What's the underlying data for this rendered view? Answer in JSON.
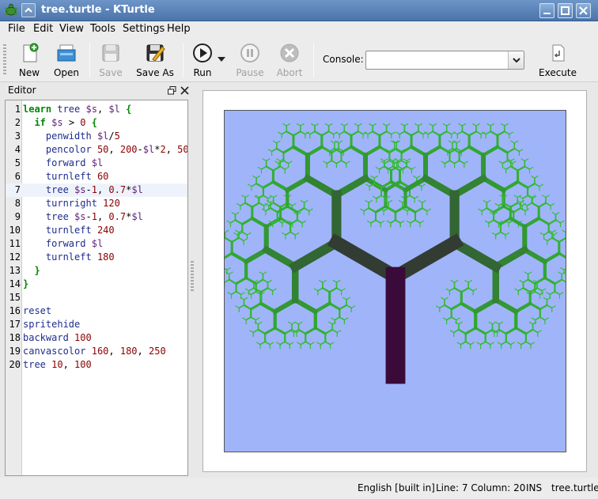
{
  "window": {
    "title": "tree.turtle - KTurtle"
  },
  "menubar": {
    "items": [
      "File",
      "Edit",
      "View",
      "Tools",
      "Settings",
      "Help"
    ]
  },
  "toolbar": {
    "new_label": "New",
    "open_label": "Open",
    "save_label": "Save",
    "save_as_label": "Save As",
    "run_label": "Run",
    "pause_label": "Pause",
    "abort_label": "Abort",
    "console_label": "Console:",
    "console_value": "",
    "execute_label": "Execute"
  },
  "editor": {
    "dock_title": "Editor",
    "current_line": 7,
    "lines": [
      "learn tree $s, $l {",
      "  if $s > 0 {",
      "    penwidth $l/5",
      "    pencolor 50, 200-$l*2, 50",
      "    forward $l",
      "    turnleft 60",
      "    tree $s-1, 0.7*$l",
      "    turnright 120",
      "    tree $s-1, 0.7*$l",
      "    turnleft 240",
      "    forward $l",
      "    turnleft 180",
      "  }",
      "}",
      "",
      "reset",
      "spritehide",
      "backward 100",
      "canvascolor 160, 180, 250",
      "tree 10, 100"
    ]
  },
  "canvas": {
    "background": "#a0b4fa",
    "trunk_color": "#3a0a3a",
    "branch_color": "#2f8f2f"
  },
  "statusbar": {
    "language": "English [built in]",
    "position": "Line: 7 Column: 20",
    "mode": "INS",
    "filename": "tree.turtle"
  },
  "colors": {
    "titlebar": "#4a74ab",
    "canvas": "#a0b4fa"
  }
}
